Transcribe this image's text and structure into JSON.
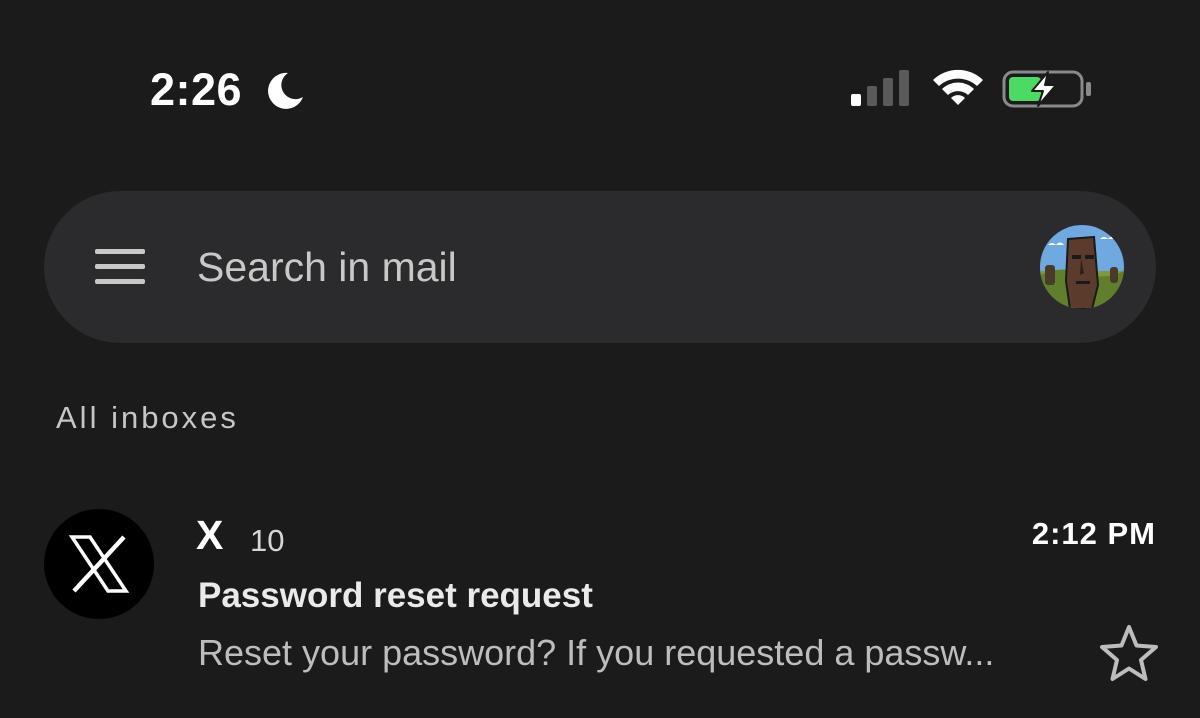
{
  "status_bar": {
    "time": "2:26",
    "focus_icon": "moon-icon",
    "signal_icon": "cellular-signal-icon",
    "wifi_icon": "wifi-icon",
    "battery_icon": "battery-charging-icon",
    "battery_color": "#4cd964"
  },
  "search": {
    "menu_icon": "hamburger-menu-icon",
    "placeholder": "Search in mail",
    "avatar_icon": "account-avatar"
  },
  "section": {
    "label": "All inboxes"
  },
  "emails": [
    {
      "sender": "X",
      "count": "10",
      "time": "2:12 PM",
      "subject": "Password reset request",
      "preview": "Reset your password? If you requested a passw...",
      "avatar_icon": "x-logo-icon",
      "star_icon": "star-outline-icon"
    }
  ],
  "colors": {
    "background": "#1b1b1c",
    "search_bar": "#2b2b2d"
  }
}
